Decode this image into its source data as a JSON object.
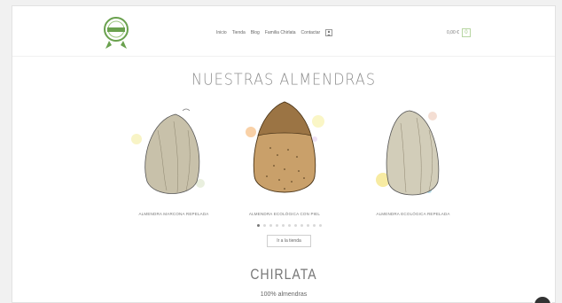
{
  "header": {
    "logo_text": "Chirlata",
    "nav": [
      {
        "label": "Inicio"
      },
      {
        "label": "Tienda"
      },
      {
        "label": "Blog"
      },
      {
        "label": "Familia Chirlata"
      },
      {
        "label": "Contactar"
      }
    ],
    "cart_total": "0,00 €",
    "cart_count": "0"
  },
  "section_title": "NUESTRAS ALMENDRAS",
  "products": [
    {
      "name": "ALMENDRA MARCONA REPELADA",
      "icon": "almond-marcona-image"
    },
    {
      "name": "ALMENDRA ECOLÓGICA CON PIEL",
      "icon": "almond-ecologica-con-piel-image"
    },
    {
      "name": "ALMENDRA ECOLÓGICA REPELADA",
      "icon": "almond-ecologica-repelada-image"
    }
  ],
  "carousel": {
    "total_dots": 11,
    "active_index": 0
  },
  "shop_button_label": "Ir a la tienda",
  "brand": {
    "heading": "CHIRLATA",
    "subheading": "100% almendras"
  },
  "colors": {
    "accent_green": "#9bc57f",
    "almond_brown": "#9b7444",
    "almond_pale": "#c8c1aa"
  }
}
